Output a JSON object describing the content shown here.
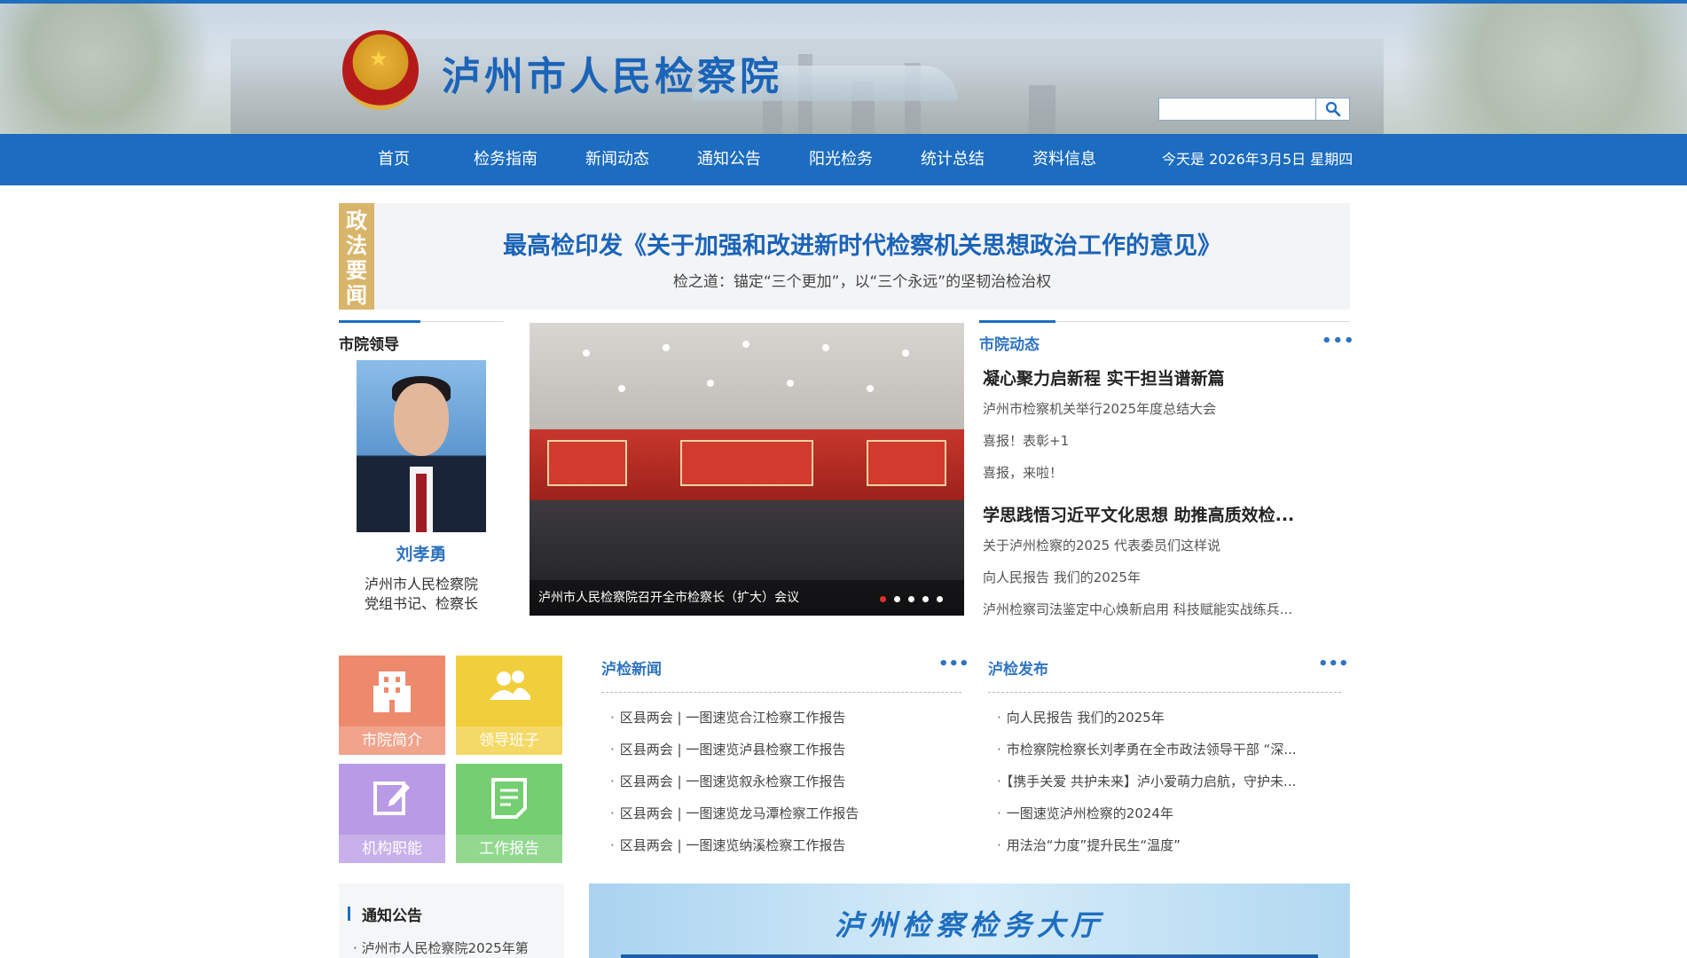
{
  "header": {
    "site_title": "泸州市人民检察院",
    "search": {
      "value": "",
      "placeholder": ""
    }
  },
  "nav": {
    "items": [
      "首页",
      "检务指南",
      "新闻动态",
      "通知公告",
      "阳光检务",
      "统计总结",
      "资料信息"
    ],
    "date_text": "今天是 2026年3月5日 星期四"
  },
  "headline": {
    "tag": "政法要闻",
    "title": "最高检印发《关于加强和改进新时代检察机关思想政治工作的意见》",
    "subtitle": "检之道：锚定“三个更加”，以“三个永远”的坚韧治检治权"
  },
  "leader": {
    "section_title": "市院领导",
    "name": "刘孝勇",
    "role_line1": "泸州市人民检察院",
    "role_line2": "党组书记、检察长"
  },
  "carousel": {
    "caption": "泸州市人民检察院召开全市检察长（扩大）会议",
    "slide_count": 5,
    "active_index": 0
  },
  "city_news": {
    "section_title": "市院动态",
    "more": "•••",
    "groups": [
      {
        "headline": "凝心聚力启新程 实干担当谱新篇",
        "items": [
          "泸州市检察机关举行2025年度总结大会",
          "喜报！表彰+1",
          "喜报，来啦！"
        ]
      },
      {
        "headline": "学思践悟习近平文化思想 助推高质效检...",
        "items": [
          "关于泸州检察的2025 代表委员们这样说",
          "向人民报告 我们的2025年",
          "泸州检察司法鉴定中心焕新启用 科技赋能实战练兵..."
        ]
      }
    ]
  },
  "tiles": [
    {
      "label": "市院简介",
      "icon": "building-icon",
      "color": "#ee8a6c"
    },
    {
      "label": "领导班子",
      "icon": "users-icon",
      "color": "#f1cf3c"
    },
    {
      "label": "机构职能",
      "icon": "edit-icon",
      "color": "#b99ae6"
    },
    {
      "label": "工作报告",
      "icon": "document-icon",
      "color": "#74cf70"
    }
  ],
  "lujian_news": {
    "title": "泸检新闻",
    "more": "•••",
    "items": [
      "区县两会 | 一图速览合江检察工作报告",
      "区县两会 | 一图速览泸县检察工作报告",
      "区县两会 | 一图速览叙永检察工作报告",
      "区县两会 | 一图速览龙马潭检察工作报告",
      "区县两会 | 一图速览纳溪检察工作报告"
    ]
  },
  "lujian_release": {
    "title": "泸检发布",
    "more": "•••",
    "items": [
      "向人民报告 我们的2025年",
      "市检察院检察长刘孝勇在全市政法领导干部 “深...",
      "【携手关爱 共护未来】泸小爱萌力启航，守护未...",
      "一图速览泸州检察的2024年",
      "用法治“力度”提升民生“温度”"
    ]
  },
  "notice": {
    "title": "通知公告",
    "first_item": "泸州市人民检察院2025年第"
  },
  "hall_banner": {
    "title": "泸州检察检务大厅"
  }
}
